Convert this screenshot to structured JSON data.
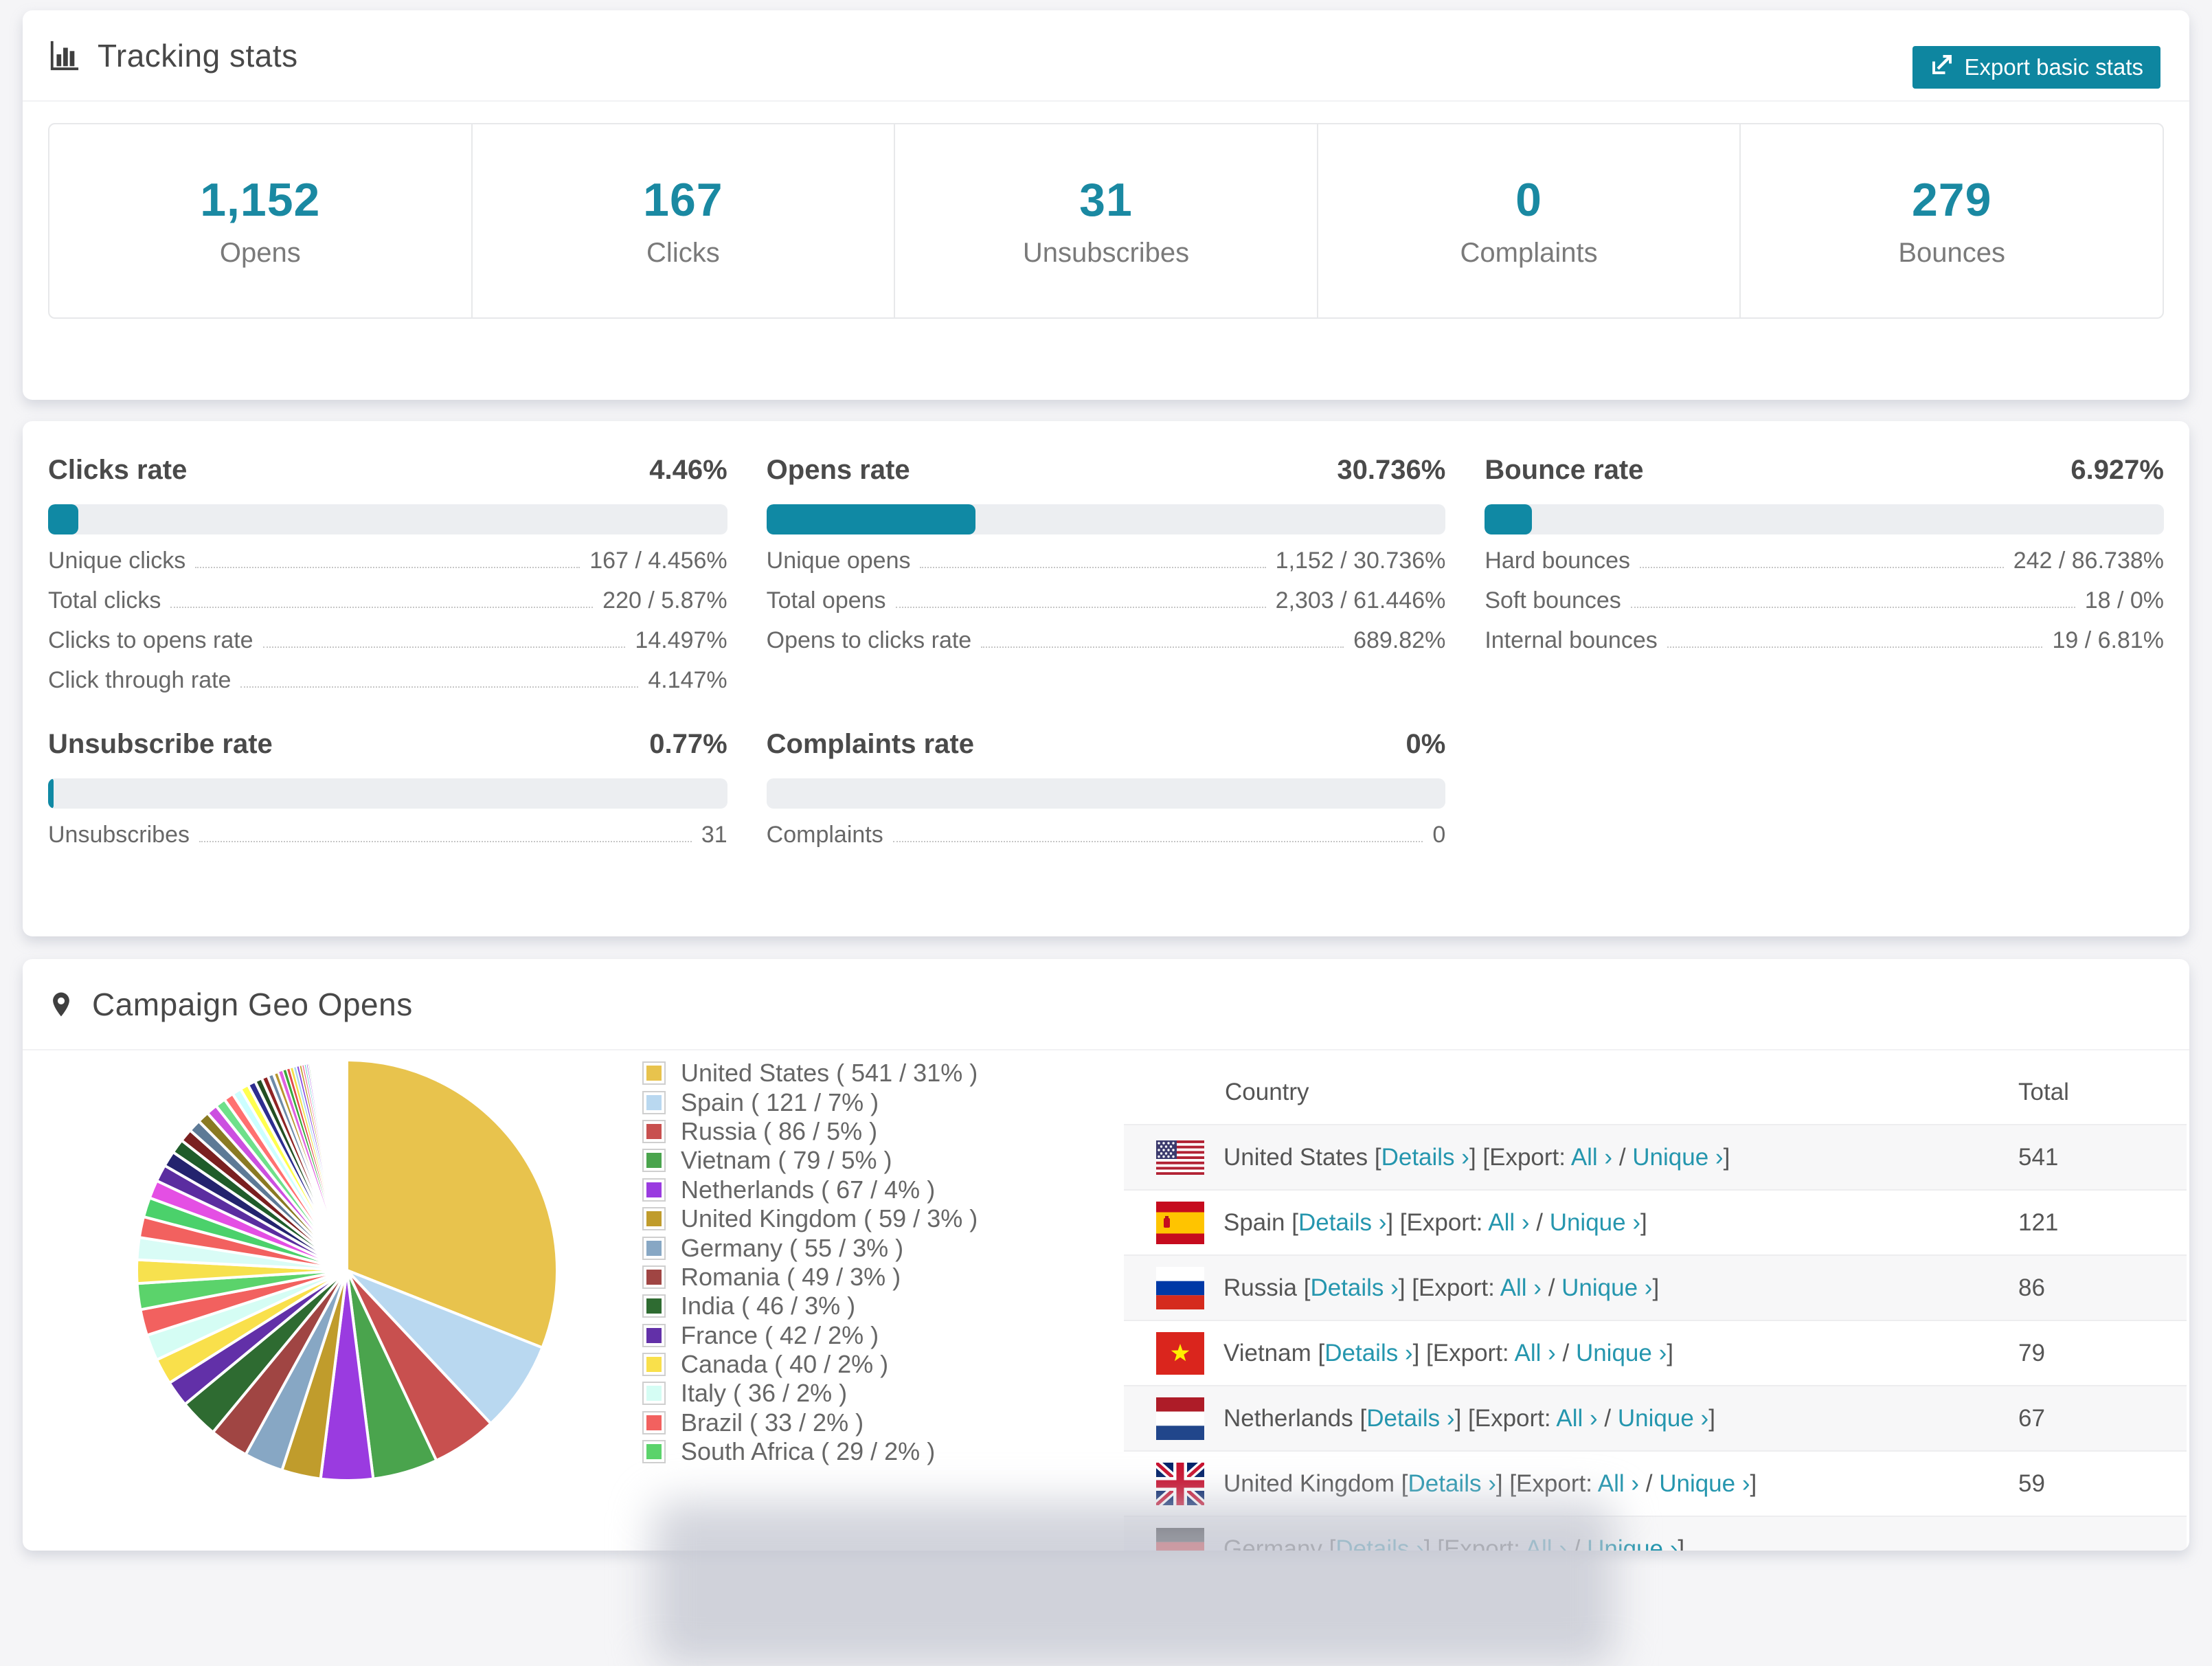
{
  "accent_color": "#1089a4",
  "page_bg": "#f5f5f7",
  "tracking": {
    "title": "Tracking stats",
    "export_button": "Export basic stats",
    "stats": [
      {
        "value": "1,152",
        "label": "Opens"
      },
      {
        "value": "167",
        "label": "Clicks"
      },
      {
        "value": "31",
        "label": "Unsubscribes"
      },
      {
        "value": "0",
        "label": "Complaints"
      },
      {
        "value": "279",
        "label": "Bounces"
      }
    ]
  },
  "rates": {
    "blocks": [
      {
        "title": "Clicks rate",
        "value": "4.46%",
        "fill_pct": 4.46,
        "rows": [
          {
            "label": "Unique clicks",
            "value": "167 / 4.456%"
          },
          {
            "label": "Total clicks",
            "value": "220 / 5.87%"
          },
          {
            "label": "Clicks to opens rate",
            "value": "14.497%"
          },
          {
            "label": "Click through rate",
            "value": "4.147%"
          }
        ]
      },
      {
        "title": "Opens rate",
        "value": "30.736%",
        "fill_pct": 30.736,
        "rows": [
          {
            "label": "Unique opens",
            "value": "1,152 / 30.736%"
          },
          {
            "label": "Total opens",
            "value": "2,303 / 61.446%"
          },
          {
            "label": "Opens to clicks rate",
            "value": "689.82%"
          }
        ]
      },
      {
        "title": "Bounce rate",
        "value": "6.927%",
        "fill_pct": 6.927,
        "rows": [
          {
            "label": "Hard bounces",
            "value": "242 / 86.738%"
          },
          {
            "label": "Soft bounces",
            "value": "18 / 0%"
          },
          {
            "label": "Internal bounces",
            "value": "19 / 6.81%"
          }
        ]
      },
      {
        "title": "Unsubscribe rate",
        "value": "0.77%",
        "fill_pct": 0.77,
        "rows": [
          {
            "label": "Unsubscribes",
            "value": "31"
          }
        ]
      },
      {
        "title": "Complaints rate",
        "value": "0%",
        "fill_pct": 0,
        "rows": [
          {
            "label": "Complaints",
            "value": "0"
          }
        ]
      }
    ]
  },
  "geo": {
    "title": "Campaign Geo Opens",
    "chart_data": {
      "type": "pie",
      "title": "Campaign Geo Opens",
      "legend_position": "right of pie",
      "start_angle": "12 o'clock, clockwise",
      "series": [
        {
          "name": "United States",
          "count": 541,
          "pct": 31,
          "color": "#e8c34d"
        },
        {
          "name": "Spain",
          "count": 121,
          "pct": 7,
          "color": "#b9d8f0"
        },
        {
          "name": "Russia",
          "count": 86,
          "pct": 5,
          "color": "#c8504f"
        },
        {
          "name": "Vietnam",
          "count": 79,
          "pct": 5,
          "color": "#4aa44d"
        },
        {
          "name": "Netherlands",
          "count": 67,
          "pct": 4,
          "color": "#9a3be0"
        },
        {
          "name": "United Kingdom",
          "count": 59,
          "pct": 3,
          "color": "#c09c2c"
        },
        {
          "name": "Germany",
          "count": 55,
          "pct": 3,
          "color": "#87a7c4"
        },
        {
          "name": "Romania",
          "count": 49,
          "pct": 3,
          "color": "#a04543"
        },
        {
          "name": "India",
          "count": 46,
          "pct": 3,
          "color": "#2e6b31"
        },
        {
          "name": "France",
          "count": 42,
          "pct": 2,
          "color": "#6230a8"
        },
        {
          "name": "Canada",
          "count": 40,
          "pct": 2,
          "color": "#f9e04b"
        },
        {
          "name": "Italy",
          "count": 36,
          "pct": 2,
          "color": "#d5fdf4"
        },
        {
          "name": "Brazil",
          "count": 33,
          "pct": 2,
          "color": "#f2615f"
        },
        {
          "name": "South Africa",
          "count": 29,
          "pct": 2,
          "color": "#5bd36b"
        }
      ],
      "unlabeled_small_slices": {
        "est_pcts": [
          1.8,
          1.7,
          1.6,
          1.5,
          1.4,
          1.3,
          1.2,
          1.1,
          1.0,
          0.95,
          0.9,
          0.85,
          0.8,
          0.75,
          0.7,
          0.65,
          0.6,
          0.55,
          0.5,
          0.45,
          0.4,
          0.35,
          0.3,
          0.28,
          0.26,
          0.24,
          0.22,
          0.2,
          0.18,
          0.16,
          0.14,
          0.12,
          0.1,
          0.09,
          0.08,
          0.07,
          0.06,
          0.05,
          0.04,
          0.03
        ],
        "colors": [
          "#f7e14e",
          "#d9fcf6",
          "#f2615f",
          "#4bd16b",
          "#e44fe4",
          "#5b2da0",
          "#23236e",
          "#1f5c2a",
          "#7a2020",
          "#5d7a96",
          "#8a7a22",
          "#cc4fe0",
          "#6ee08a",
          "#ff7070",
          "#ccffff",
          "#ffff4f",
          "#2d2d8f",
          "#234f23",
          "#8f2424",
          "#6d8aa8",
          "#b8962d",
          "#e060e0",
          "#3aa83a",
          "#e04a4a",
          "#f2e04a",
          "#a8d8f0",
          "#8a4ae0",
          "#c09c2c",
          "#f06d9e",
          "#66cccc",
          "#9a3be0",
          "#4aa44d",
          "#c8504f",
          "#e8c34d",
          "#b9d8f0",
          "#5bd36b",
          "#d5fdf4",
          "#6230a8",
          "#f7e14e",
          "#e44fe4"
        ]
      }
    },
    "legend_format": "{name} ( {count} / {pct}% )",
    "table": {
      "headers": {
        "country": "Country",
        "total": "Total"
      },
      "link_labels": {
        "details": "Details ›",
        "export_prefix": "Export:",
        "all": "All ›",
        "unique": "Unique ›"
      },
      "rows": [
        {
          "country": "United States",
          "flag": "us",
          "total": "541"
        },
        {
          "country": "Spain",
          "flag": "es",
          "total": "121"
        },
        {
          "country": "Russia",
          "flag": "ru",
          "total": "86"
        },
        {
          "country": "Vietnam",
          "flag": "vn",
          "total": "79"
        },
        {
          "country": "Netherlands",
          "flag": "nl",
          "total": "67"
        },
        {
          "country": "United Kingdom",
          "flag": "gb",
          "total": "59"
        },
        {
          "country": "Germany",
          "flag": "de",
          "total": "",
          "partial": true
        }
      ]
    }
  }
}
